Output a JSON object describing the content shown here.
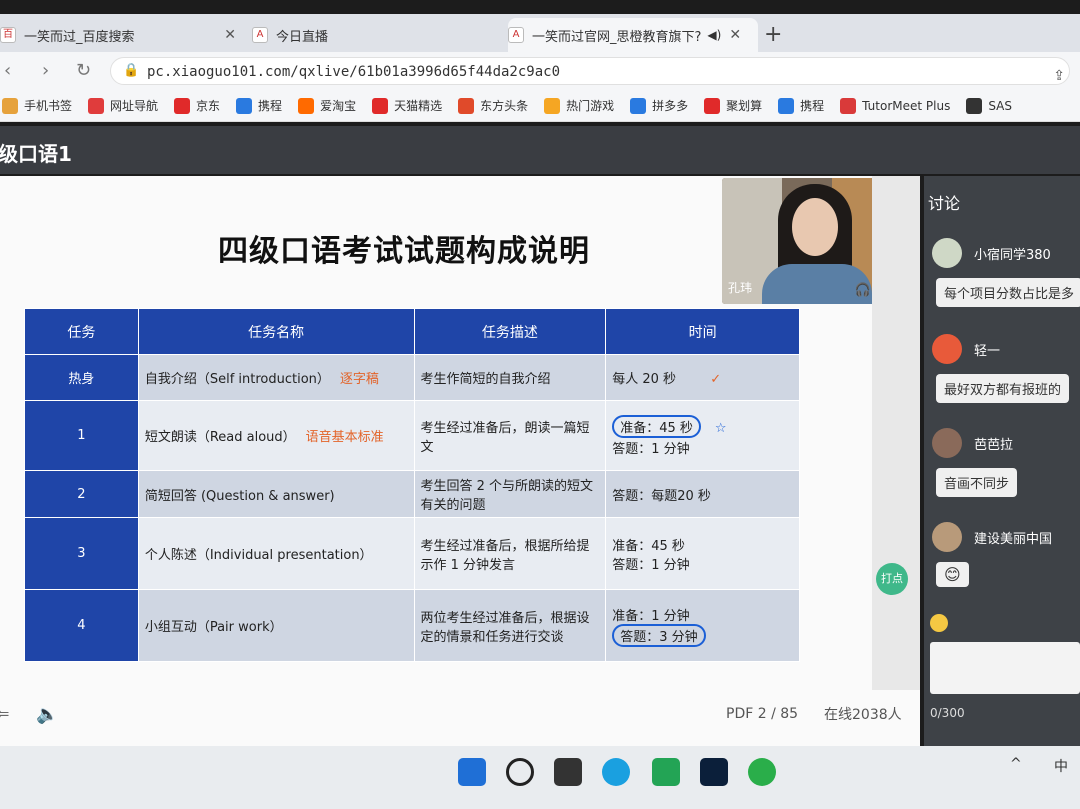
{
  "tabs": [
    {
      "label": "一笑而过_百度搜索",
      "active": false
    },
    {
      "label": "今日直播",
      "active": false
    },
    {
      "label": "一笑而过官网_思橙教育旗下?",
      "active": true
    }
  ],
  "address": {
    "url": "pc.xiaoguo101.com/qxlive/61b01a3996d65f44da2c9ac0"
  },
  "bookmarks": [
    {
      "label": "手机书签",
      "color": "#e6a23c"
    },
    {
      "label": "网址导航",
      "color": "#e03c3c"
    },
    {
      "label": "京东",
      "color": "#e02a2a"
    },
    {
      "label": "携程",
      "color": "#2a7ae0"
    },
    {
      "label": "爱淘宝",
      "color": "#ff6a00"
    },
    {
      "label": "天猫精选",
      "color": "#e02a2a"
    },
    {
      "label": "东方头条",
      "color": "#e04a2a"
    },
    {
      "label": "热门游戏",
      "color": "#f5a623"
    },
    {
      "label": "拼多多",
      "color": "#2a7ae0"
    },
    {
      "label": "聚划算",
      "color": "#e02a2a"
    },
    {
      "label": "携程",
      "color": "#2a7ae0"
    },
    {
      "label": "TutorMeet Plus",
      "color": "#d93a3a"
    },
    {
      "label": "SAS",
      "color": "#333333"
    }
  ],
  "course": {
    "title": "级口语1"
  },
  "slide": {
    "title": "四级口语考试试题构成说明",
    "headers": [
      "任务",
      "任务名称",
      "任务描述",
      "时间"
    ],
    "rows": [
      {
        "idx": "热身",
        "name": "自我介绍（Self introduction）",
        "note": "逐字稿",
        "desc": "考生作简短的自我介绍",
        "time1": "每人 20 秒",
        "time2": ""
      },
      {
        "idx": "1",
        "name": "短文朗读（Read aloud）",
        "note": "语音基本标准",
        "desc": "考生经过准备后，朗读一篇短文",
        "time1": "准备：45 秒",
        "time2": "答题：1 分钟"
      },
      {
        "idx": "2",
        "name": "简短回答 (Question & answer)",
        "note": "",
        "desc": "考生回答 2 个与所朗读的短文有关的问题",
        "time1": "答题：每题20 秒",
        "time2": ""
      },
      {
        "idx": "3",
        "name": "个人陈述（Individual presentation）",
        "note": "",
        "desc": "考生经过准备后，根据所给提示作 1 分钟发言",
        "time1": "准备：45 秒",
        "time2": "答题：1 分钟"
      },
      {
        "idx": "4",
        "name": "小组互动（Pair work）",
        "note": "",
        "desc": "两位考生经过准备后，根据设定的情景和任务进行交谈",
        "time1": "准备：1 分钟",
        "time2": "答题：3 分钟"
      }
    ],
    "webcam_name": "孔玮",
    "dian_label": "打点",
    "pdf_page": "PDF 2 / 85",
    "online": "在线2038人"
  },
  "discussion": {
    "title": "讨论",
    "messages": [
      {
        "user": "小宿同学380",
        "text": "每个项目分数占比是多"
      },
      {
        "user": "轻一",
        "text": "最好双方都有报班的"
      },
      {
        "user": "芭芭拉",
        "text": "音画不同步"
      },
      {
        "user": "建设美丽中国",
        "text": ""
      }
    ],
    "counter": "0/300"
  },
  "taskbar": {
    "lang": "中"
  }
}
